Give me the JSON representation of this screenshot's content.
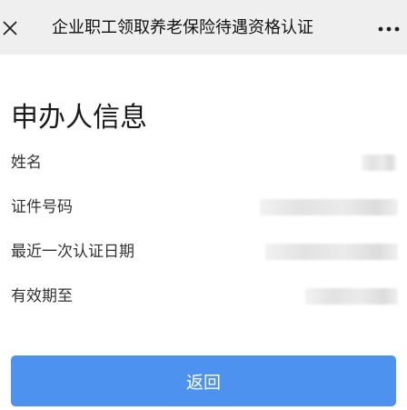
{
  "header": {
    "title": "企业职工领取养老保险待遇资格认证",
    "close_icon": "close-icon",
    "more_icon": "more-icon"
  },
  "section": {
    "title": "申办人信息"
  },
  "info": {
    "rows": [
      {
        "label": "姓名"
      },
      {
        "label": "证件号码"
      },
      {
        "label": "最近一次认证日期"
      },
      {
        "label": "有效期至"
      }
    ]
  },
  "actions": {
    "return_label": "返回",
    "button_color": "#4e92f0"
  }
}
